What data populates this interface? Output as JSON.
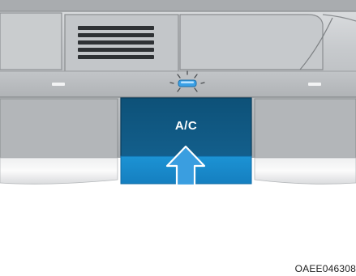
{
  "ac_button": {
    "label": "A/C",
    "indicator_state": "on"
  },
  "figure_code": "OAEE046308",
  "icons": {
    "indicator": "indicator-light-icon",
    "arrow": "press-arrow-icon",
    "vent": "air-vent-icon"
  },
  "colors": {
    "ac_button_top": "#0f5680",
    "ac_button_bottom": "#1a8fd0",
    "indicator_led": "#3aa0e6",
    "panel_gray": "#b8bcc0",
    "arrow_fill": "#3a9ee0"
  }
}
